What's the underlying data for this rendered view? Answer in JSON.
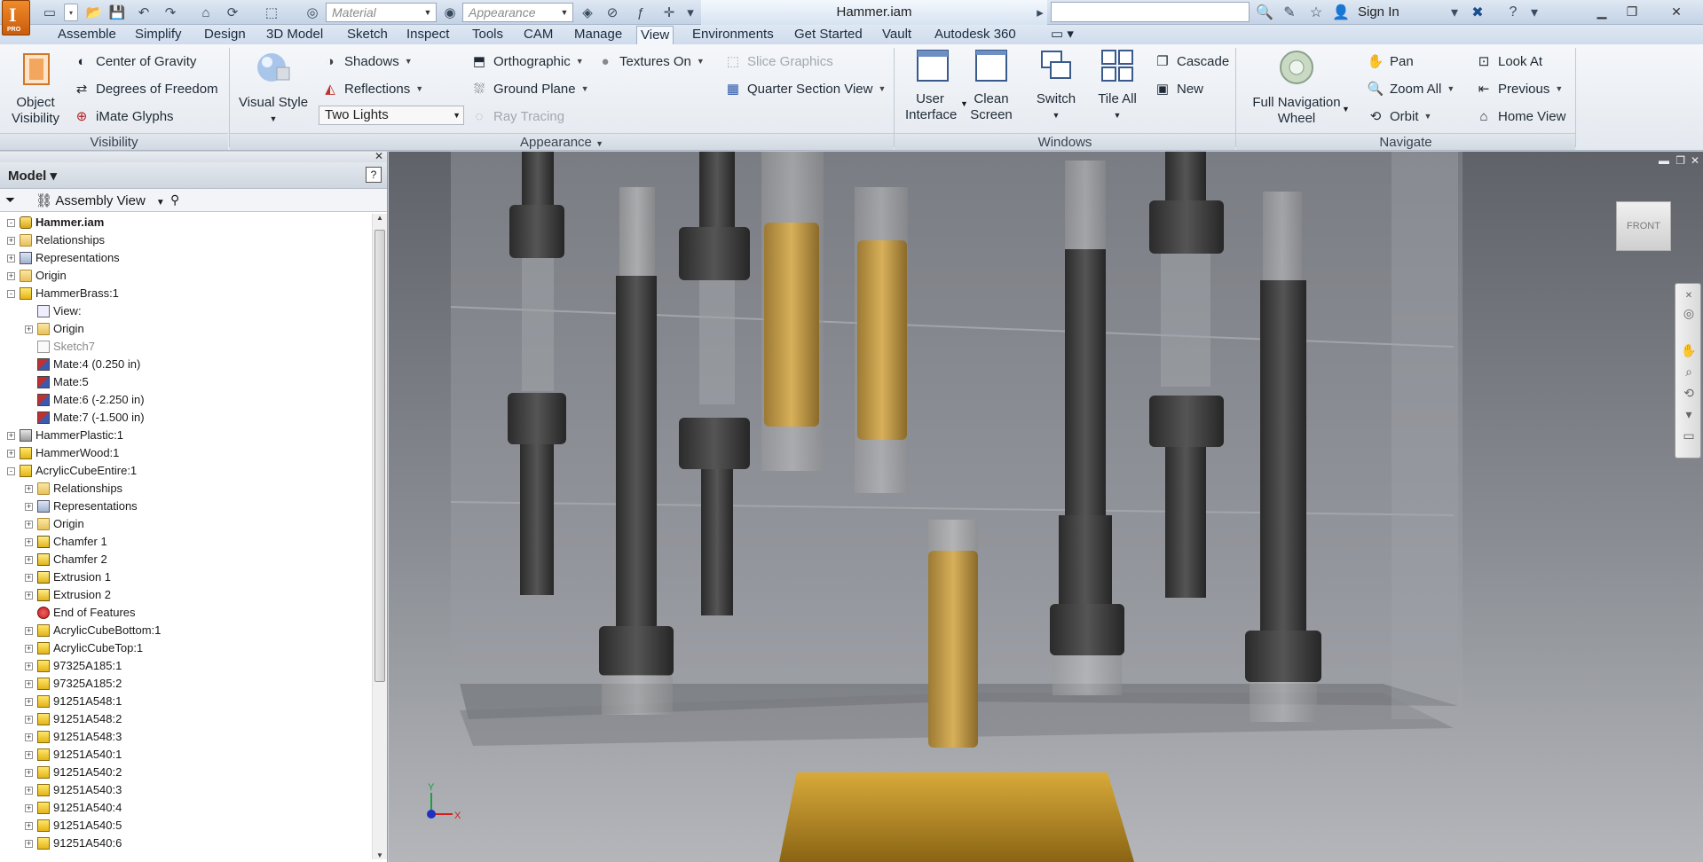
{
  "app": {
    "logo_letter": "I",
    "logo_edition": "PRO",
    "document_title": "Hammer.iam",
    "material_placeholder": "Material",
    "appearance_placeholder": "Appearance",
    "sign_in": "Sign In"
  },
  "tabs": [
    "Assemble",
    "Simplify",
    "Design",
    "3D Model",
    "Sketch",
    "Inspect",
    "Tools",
    "CAM",
    "Manage",
    "View",
    "Environments",
    "Get Started",
    "Vault",
    "Autodesk 360"
  ],
  "active_tab": "View",
  "ribbon": {
    "visibility": {
      "title": "Visibility",
      "object_visibility": "Object Visibility",
      "center_of_gravity": "Center of Gravity",
      "degrees_of_freedom": "Degrees of Freedom",
      "imate_glyphs": "iMate Glyphs"
    },
    "appearance": {
      "title": "Appearance",
      "visual_style": "Visual Style",
      "shadows": "Shadows",
      "reflections": "Reflections",
      "lighting": "Two Lights",
      "orthographic": "Orthographic",
      "ground_plane": "Ground Plane",
      "ray_tracing": "Ray Tracing",
      "textures_on": "Textures On",
      "slice_graphics": "Slice Graphics",
      "quarter_section_view": "Quarter Section View"
    },
    "windows": {
      "title": "Windows",
      "user_interface": "User Interface",
      "clean_screen": "Clean Screen",
      "switch": "Switch",
      "tile_all": "Tile All",
      "cascade": "Cascade",
      "new": "New"
    },
    "navigate": {
      "title": "Navigate",
      "full_navigation_wheel": "Full Navigation Wheel",
      "pan": "Pan",
      "zoom_all": "Zoom All",
      "orbit": "Orbit",
      "look_at": "Look At",
      "previous": "Previous",
      "home_view": "Home View"
    }
  },
  "browser": {
    "title": "Model",
    "view_mode": "Assembly View",
    "tree": [
      {
        "label": "Hammer.iam",
        "depth": 0,
        "icon": "asm",
        "exp": "-",
        "bold": true
      },
      {
        "label": "Relationships",
        "depth": 0,
        "icon": "folder",
        "exp": "+"
      },
      {
        "label": "Representations",
        "depth": 0,
        "icon": "rep",
        "exp": "+"
      },
      {
        "label": "Origin",
        "depth": 0,
        "icon": "folder",
        "exp": "+"
      },
      {
        "label": "HammerBrass:1",
        "depth": 0,
        "icon": "part",
        "exp": "-"
      },
      {
        "label": "View:",
        "depth": 1,
        "icon": "view",
        "exp": ""
      },
      {
        "label": "Origin",
        "depth": 1,
        "icon": "folder",
        "exp": "+"
      },
      {
        "label": "Sketch7",
        "depth": 1,
        "icon": "sketch",
        "exp": "",
        "dim": true
      },
      {
        "label": "Mate:4 (0.250 in)",
        "depth": 1,
        "icon": "mate",
        "exp": ""
      },
      {
        "label": "Mate:5",
        "depth": 1,
        "icon": "mate",
        "exp": ""
      },
      {
        "label": "Mate:6 (-2.250 in)",
        "depth": 1,
        "icon": "mate",
        "exp": ""
      },
      {
        "label": "Mate:7 (-1.500 in)",
        "depth": 1,
        "icon": "mate",
        "exp": ""
      },
      {
        "label": "HammerPlastic:1",
        "depth": 0,
        "icon": "gray",
        "exp": "+"
      },
      {
        "label": "HammerWood:1",
        "depth": 0,
        "icon": "part",
        "exp": "+"
      },
      {
        "label": "AcrylicCubeEntire:1",
        "depth": 0,
        "icon": "part",
        "exp": "-"
      },
      {
        "label": "Relationships",
        "depth": 1,
        "icon": "folder",
        "exp": "+"
      },
      {
        "label": "Representations",
        "depth": 1,
        "icon": "rep",
        "exp": "+"
      },
      {
        "label": "Origin",
        "depth": 1,
        "icon": "folder",
        "exp": "+"
      },
      {
        "label": "Chamfer 1",
        "depth": 1,
        "icon": "feat",
        "exp": "+"
      },
      {
        "label": "Chamfer 2",
        "depth": 1,
        "icon": "feat",
        "exp": "+"
      },
      {
        "label": "Extrusion 1",
        "depth": 1,
        "icon": "feat",
        "exp": "+"
      },
      {
        "label": "Extrusion 2",
        "depth": 1,
        "icon": "feat",
        "exp": "+"
      },
      {
        "label": "End of Features",
        "depth": 1,
        "icon": "eof",
        "exp": ""
      },
      {
        "label": "AcrylicCubeBottom:1",
        "depth": 1,
        "icon": "part",
        "exp": "+"
      },
      {
        "label": "AcrylicCubeTop:1",
        "depth": 1,
        "icon": "part",
        "exp": "+"
      },
      {
        "label": "97325A185:1",
        "depth": 1,
        "icon": "part",
        "exp": "+"
      },
      {
        "label": "97325A185:2",
        "depth": 1,
        "icon": "part",
        "exp": "+"
      },
      {
        "label": "91251A548:1",
        "depth": 1,
        "icon": "part",
        "exp": "+"
      },
      {
        "label": "91251A548:2",
        "depth": 1,
        "icon": "part",
        "exp": "+"
      },
      {
        "label": "91251A548:3",
        "depth": 1,
        "icon": "part",
        "exp": "+"
      },
      {
        "label": "91251A540:1",
        "depth": 1,
        "icon": "part",
        "exp": "+"
      },
      {
        "label": "91251A540:2",
        "depth": 1,
        "icon": "part",
        "exp": "+"
      },
      {
        "label": "91251A540:3",
        "depth": 1,
        "icon": "part",
        "exp": "+"
      },
      {
        "label": "91251A540:4",
        "depth": 1,
        "icon": "part",
        "exp": "+"
      },
      {
        "label": "91251A540:5",
        "depth": 1,
        "icon": "part",
        "exp": "+"
      },
      {
        "label": "91251A540:6",
        "depth": 1,
        "icon": "part",
        "exp": "+"
      }
    ]
  },
  "viewport": {
    "viewcube_face": "FRONT",
    "triad_x": "X",
    "triad_y": "Y"
  }
}
